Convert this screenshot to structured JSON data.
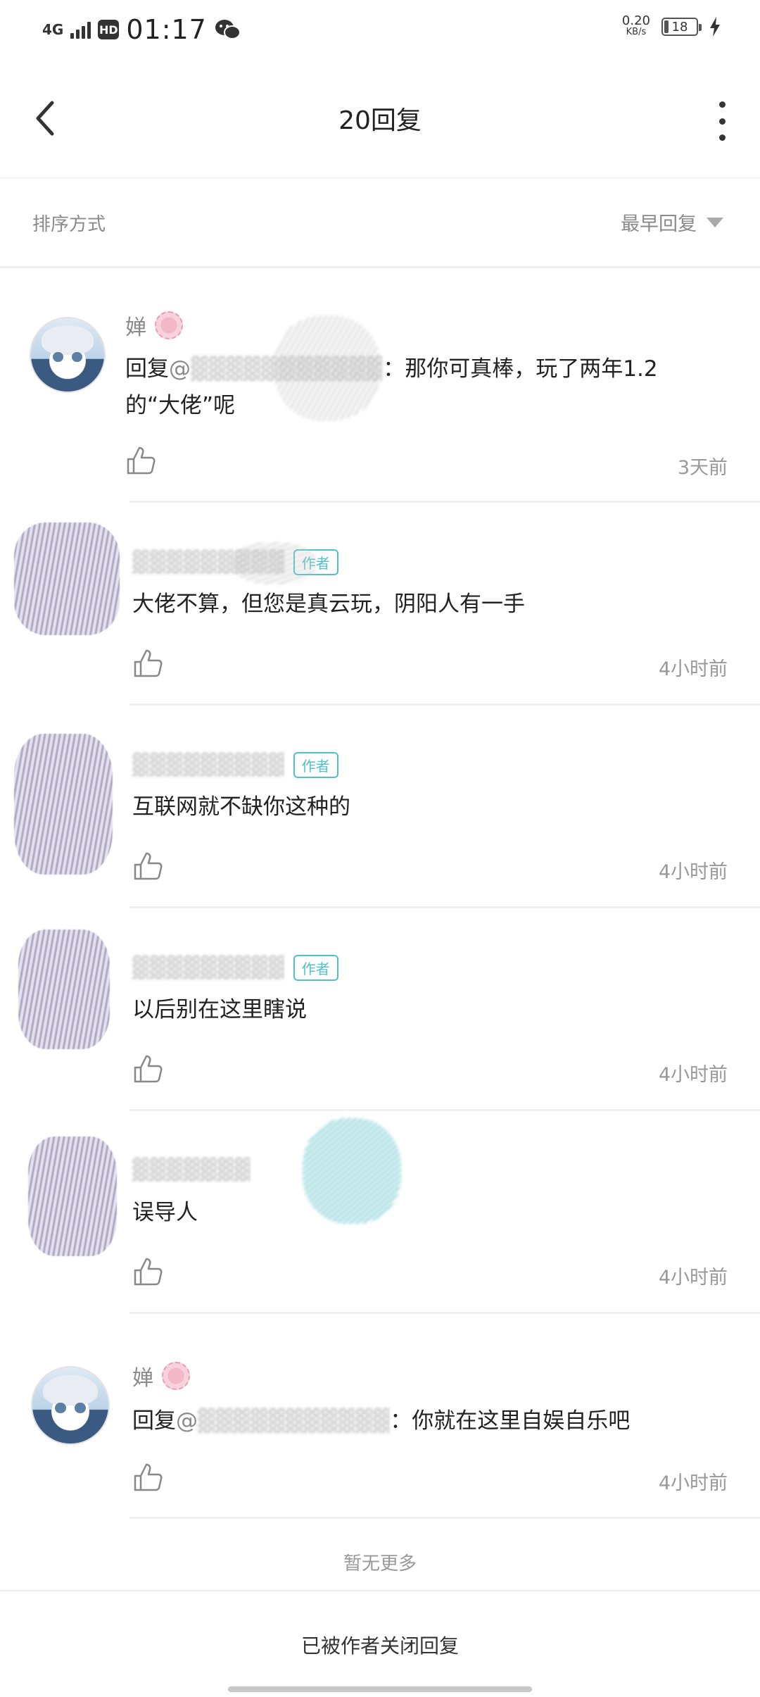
{
  "status_bar": {
    "network": "4G",
    "hd": "HD",
    "time": "01:17",
    "speed_value": "0.20",
    "speed_unit": "KB/s",
    "battery": "18"
  },
  "header": {
    "title": "20回复"
  },
  "sort": {
    "label": "排序方式",
    "selected": "最早回复"
  },
  "author_badge": "作者",
  "comments": [
    {
      "username": "婵",
      "reply_prefix": "回复",
      "reply_target": "@",
      "content": "：那你可真棒，玩了两年1.2的“大佬”呢",
      "time": "3天前"
    },
    {
      "username": "",
      "content": "大佬不算，但您是真云玩，阴阳人有一手",
      "time": "4小时前"
    },
    {
      "username": "",
      "content": "互联网就不缺你这种的",
      "time": "4小时前"
    },
    {
      "username": "",
      "content": "以后别在这里瞎说",
      "time": "4小时前"
    },
    {
      "username": "",
      "content": "误导人",
      "time": "4小时前"
    },
    {
      "username": "婵",
      "reply_prefix": "回复",
      "reply_target": "@",
      "content": "：你就在这里自娱自乐吧",
      "time": "4小时前"
    }
  ],
  "no_more": "暂无更多",
  "footer": {
    "text": "已被作者关闭回复"
  }
}
